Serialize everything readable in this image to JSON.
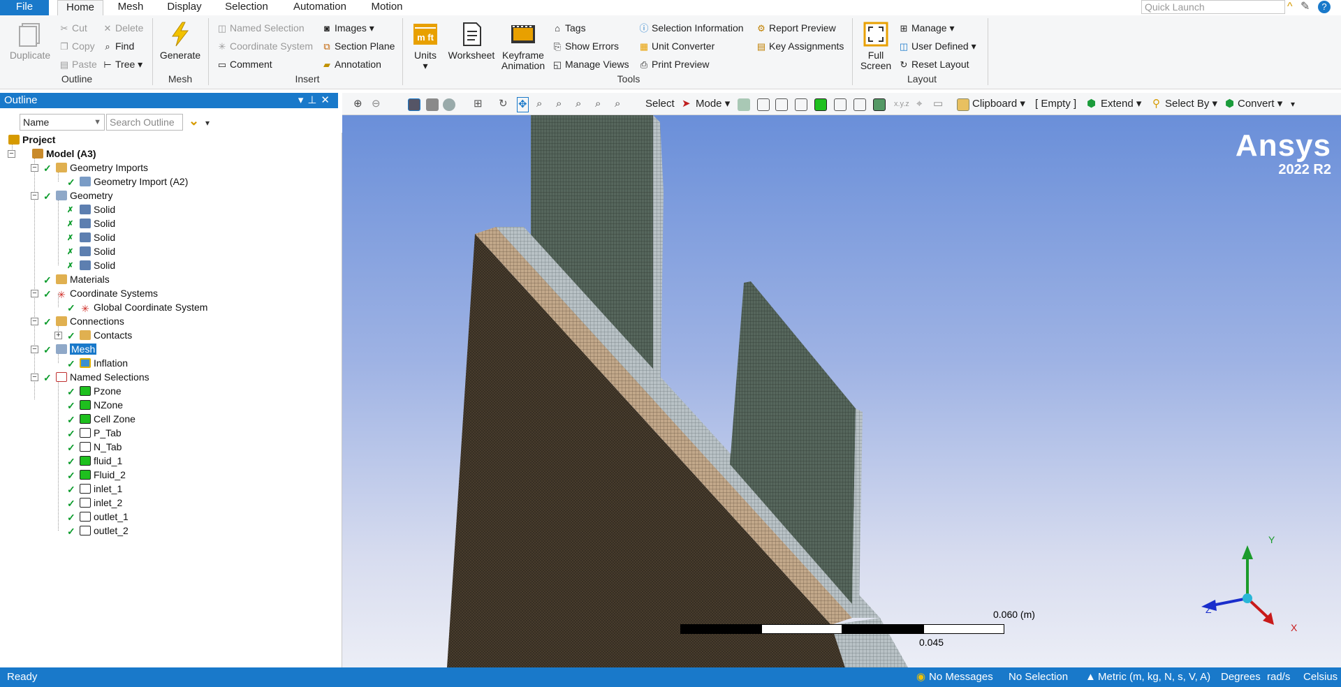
{
  "menu": {
    "file": "File",
    "tabs": [
      "Home",
      "Mesh",
      "Display",
      "Selection",
      "Automation",
      "Motion"
    ],
    "active_tab": "Home",
    "quick_launch_placeholder": "Quick Launch"
  },
  "ribbon": {
    "outline_group": {
      "label": "Outline",
      "duplicate": "Duplicate",
      "cut": "Cut",
      "copy": "Copy",
      "paste": "Paste",
      "delete": "Delete",
      "find": "Find",
      "tree": "Tree"
    },
    "mesh_group": {
      "label": "Mesh",
      "generate": "Generate"
    },
    "insert_group": {
      "label": "Insert",
      "named_selection": "Named Selection",
      "coordinate_system": "Coordinate System",
      "comment": "Comment",
      "images": "Images",
      "section_plane": "Section Plane",
      "annotation": "Annotation"
    },
    "tools_group": {
      "label": "Tools",
      "units": "Units",
      "worksheet": "Worksheet",
      "keyframe_animation_1": "Keyframe",
      "keyframe_animation_2": "Animation",
      "tags": "Tags",
      "show_errors": "Show Errors",
      "manage_views": "Manage Views",
      "selection_information": "Selection Information",
      "unit_converter": "Unit Converter",
      "print_preview": "Print Preview",
      "report_preview": "Report Preview",
      "key_assignments": "Key Assignments"
    },
    "layout_group": {
      "label": "Layout",
      "full_screen_1": "Full",
      "full_screen_2": "Screen",
      "manage": "Manage",
      "user_defined": "User Defined",
      "reset_layout": "Reset Layout"
    }
  },
  "outline": {
    "title": "Outline",
    "filter_select": "Name",
    "search_placeholder": "Search Outline",
    "tree": {
      "project": "Project",
      "model": "Model (A3)",
      "geometry_imports": "Geometry Imports",
      "geometry_import_a2": "Geometry Import (A2)",
      "geometry": "Geometry",
      "solids": [
        "Solid",
        "Solid",
        "Solid",
        "Solid",
        "Solid"
      ],
      "materials": "Materials",
      "coordinate_systems": "Coordinate Systems",
      "global_coordinate_system": "Global Coordinate System",
      "connections": "Connections",
      "contacts": "Contacts",
      "mesh": "Mesh",
      "inflation": "Inflation",
      "named_selections": "Named Selections",
      "named_items": [
        "Pzone",
        "NZone",
        "Cell Zone",
        "P_Tab",
        "N_Tab",
        "fluid_1",
        "Fluid_2",
        "inlet_1",
        "inlet_2",
        "outlet_1",
        "outlet_2"
      ]
    }
  },
  "view_toolbar": {
    "select": "Select",
    "mode": "Mode",
    "clipboard": "Clipboard",
    "clipboard_value": "[ Empty ]",
    "extend": "Extend",
    "select_by": "Select By",
    "convert": "Convert"
  },
  "viewport": {
    "brand": "Ansys",
    "version": "2022 R2",
    "scale_label_top": "0.060 (m)",
    "scale_label_mid": "0.045",
    "axis_y": "Y",
    "axis_z": "Z",
    "axis_x": "X"
  },
  "status": {
    "ready": "Ready",
    "messages": "No Messages",
    "selection": "No Selection",
    "units": "Metric (m, kg, N, s, V, A)",
    "angle": "Degrees",
    "rate": "rad/s",
    "temp": "Celsius"
  },
  "colors": {
    "accent": "#1979ca",
    "mesh_dark": "#4a3e2e",
    "mesh_tab": "#5b6b60",
    "check": "#0a9b2a"
  }
}
